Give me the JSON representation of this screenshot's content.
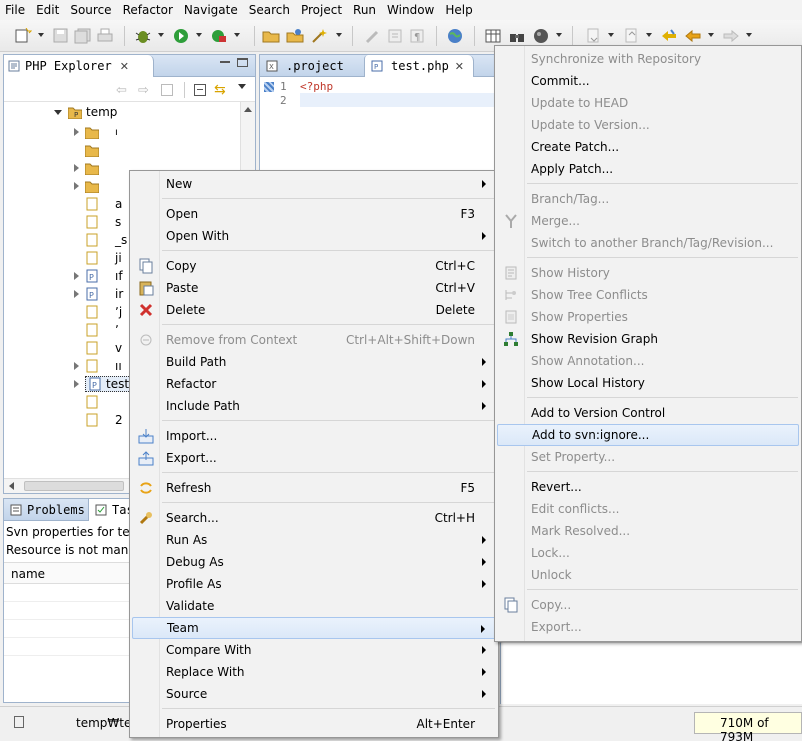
{
  "menubar": [
    "File",
    "Edit",
    "Source",
    "Refactor",
    "Navigate",
    "Search",
    "Project",
    "Run",
    "Window",
    "Help"
  ],
  "explorer": {
    "tab_label": "PHP Explorer",
    "root": "temp",
    "selected_file": "test.p",
    "fragments": [
      "ı",
      "a",
      "s",
      "_s",
      "ji",
      "ıf",
      "ir",
      "ʼj",
      "ʼ",
      "v",
      "ıı",
      "2"
    ]
  },
  "editor": {
    "tabs": [
      ".project",
      "test.php"
    ],
    "line_numbers": [
      "1",
      "2"
    ],
    "code": "<?php"
  },
  "bottom": {
    "tabs": [
      "Problems",
      "Tas"
    ],
    "line1": "Svn properties for test.p",
    "line2": "Resource is not manag",
    "column": "name"
  },
  "status": {
    "path": "temp₩tes",
    "memory": "710M of 793M"
  },
  "context_menu": [
    {
      "label": "New",
      "submenu": true,
      "icon": ""
    },
    {
      "sep": true
    },
    {
      "label": "Open",
      "accel": "F3"
    },
    {
      "label": "Open With",
      "submenu": true
    },
    {
      "sep": true
    },
    {
      "label": "Copy",
      "accel": "Ctrl+C",
      "icon": "copy-icon"
    },
    {
      "label": "Paste",
      "accel": "Ctrl+V",
      "icon": "paste-icon"
    },
    {
      "label": "Delete",
      "accel": "Delete",
      "icon": "delete-icon"
    },
    {
      "sep": true
    },
    {
      "label": "Remove from Context",
      "accel": "Ctrl+Alt+Shift+Down",
      "disabled": true,
      "icon": "remove-context-icon"
    },
    {
      "label": "Build Path",
      "submenu": true
    },
    {
      "label": "Refactor",
      "submenu": true
    },
    {
      "label": "Include Path",
      "submenu": true
    },
    {
      "sep": true
    },
    {
      "label": "Import...",
      "icon": "import-icon"
    },
    {
      "label": "Export...",
      "icon": "export-icon"
    },
    {
      "sep": true
    },
    {
      "label": "Refresh",
      "accel": "F5",
      "icon": "refresh-icon"
    },
    {
      "sep": true
    },
    {
      "label": "Search...",
      "accel": "Ctrl+H",
      "icon": "search-icon"
    },
    {
      "label": "Run As",
      "submenu": true
    },
    {
      "label": "Debug As",
      "submenu": true
    },
    {
      "label": "Profile As",
      "submenu": true
    },
    {
      "label": "Validate"
    },
    {
      "label": "Team",
      "submenu": true,
      "highlighted": true
    },
    {
      "label": "Compare With",
      "submenu": true
    },
    {
      "label": "Replace With",
      "submenu": true
    },
    {
      "label": "Source",
      "submenu": true
    },
    {
      "sep": true
    },
    {
      "label": "Properties",
      "accel": "Alt+Enter"
    }
  ],
  "team_menu": [
    {
      "label": "Synchronize with Repository",
      "disabled": true
    },
    {
      "label": "Commit..."
    },
    {
      "label": "Update to HEAD",
      "disabled": true
    },
    {
      "label": "Update to Version...",
      "disabled": true
    },
    {
      "label": "Create Patch..."
    },
    {
      "label": "Apply Patch..."
    },
    {
      "sep": true
    },
    {
      "label": "Branch/Tag...",
      "disabled": true
    },
    {
      "label": "Merge...",
      "disabled": true,
      "icon": "merge-icon"
    },
    {
      "label": "Switch to another Branch/Tag/Revision...",
      "disabled": true
    },
    {
      "sep": true
    },
    {
      "label": "Show History",
      "disabled": true,
      "icon": "history-icon"
    },
    {
      "label": "Show Tree Conflicts",
      "disabled": true,
      "icon": "tree-conflicts-icon"
    },
    {
      "label": "Show Properties",
      "disabled": true,
      "icon": "properties-icon"
    },
    {
      "label": "Show Revision Graph",
      "icon": "revision-graph-icon"
    },
    {
      "label": "Show Annotation...",
      "disabled": true
    },
    {
      "label": "Show Local History"
    },
    {
      "sep": true
    },
    {
      "label": "Add to Version Control"
    },
    {
      "label": "Add to svn:ignore...",
      "highlighted": true
    },
    {
      "label": "Set Property...",
      "disabled": true
    },
    {
      "sep": true
    },
    {
      "label": "Revert..."
    },
    {
      "label": "Edit conflicts...",
      "disabled": true
    },
    {
      "label": "Mark Resolved...",
      "disabled": true
    },
    {
      "label": "Lock...",
      "disabled": true
    },
    {
      "label": "Unlock",
      "disabled": true
    },
    {
      "sep": true
    },
    {
      "label": "Copy...",
      "disabled": true,
      "icon": "copy-icon"
    },
    {
      "label": "Export...",
      "disabled": true
    }
  ],
  "colors": {
    "view_border": "#9fb3cc",
    "tab_gradient_top": "#d9e5f4",
    "menu_bg": "#f2f2f2",
    "highlight_border": "#a8c6ee",
    "php_tag": "#c0392b",
    "memory_bg": "#ffffe1"
  }
}
